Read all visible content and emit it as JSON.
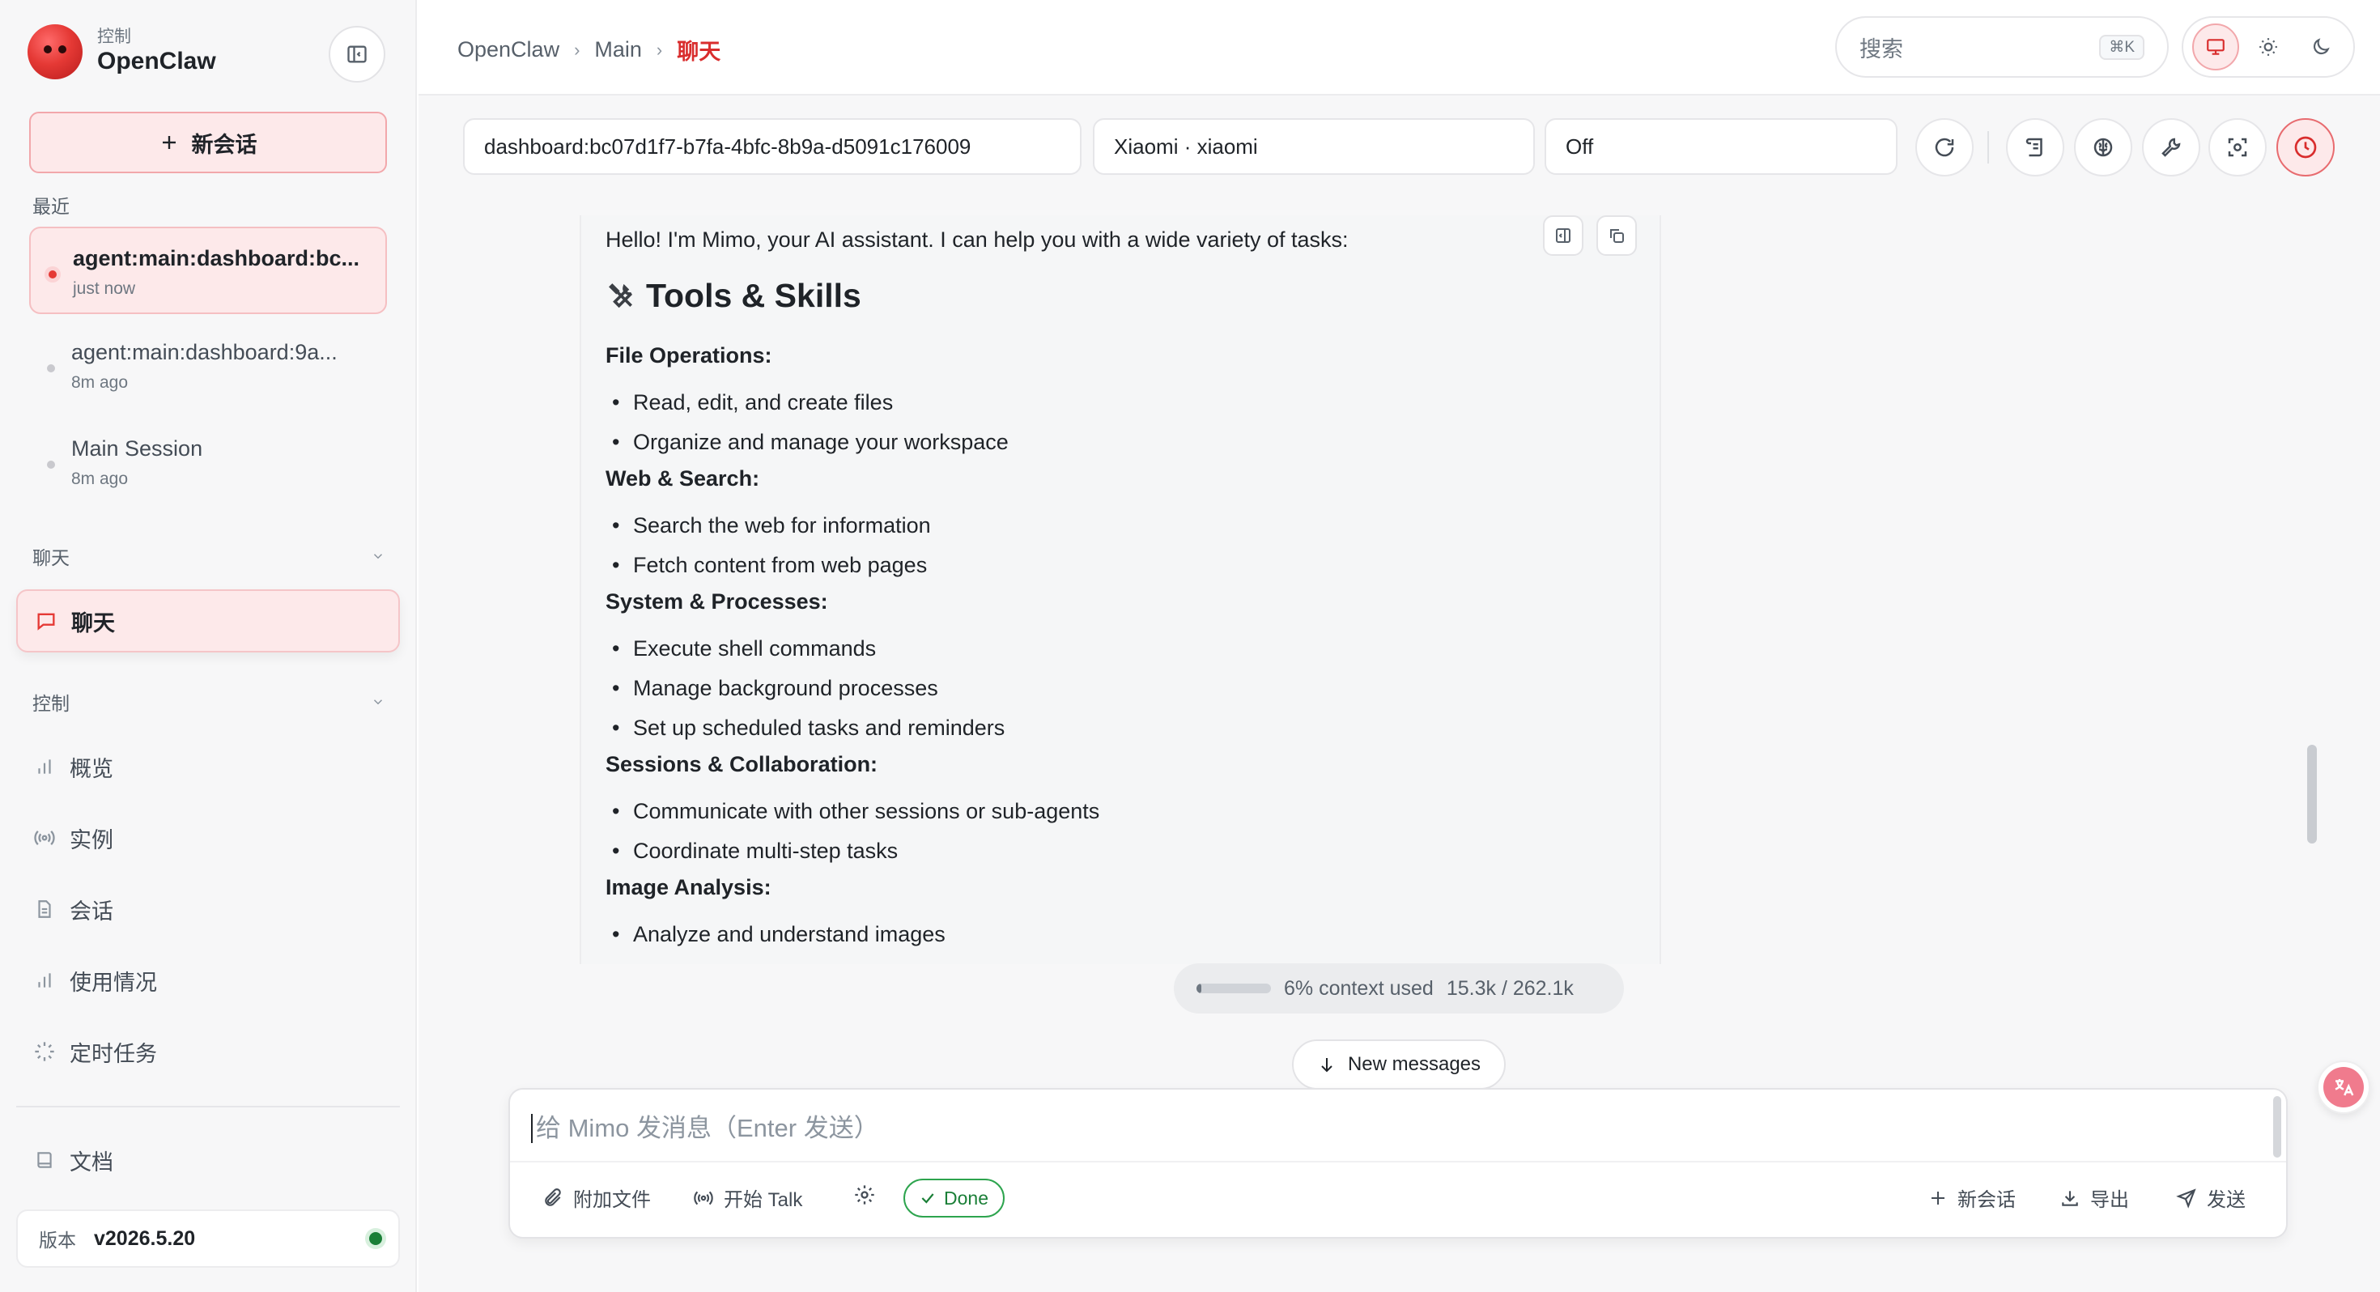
{
  "brand": {
    "subtitle": "控制",
    "name": "OpenClaw"
  },
  "sidebar": {
    "new_chat_label": "新会话",
    "recent_label": "最近",
    "sessions": [
      {
        "title": "agent:main:dashboard:bc...",
        "time": "just now",
        "active": true
      },
      {
        "title": "agent:main:dashboard:9a...",
        "time": "8m ago",
        "active": false
      },
      {
        "title": "Main Session",
        "time": "8m ago",
        "active": false
      }
    ],
    "group_chat": "聊天",
    "nav_chat": "聊天",
    "group_control": "控制",
    "nav_items": [
      "概览",
      "实例",
      "会话",
      "使用情况",
      "定时任务"
    ],
    "nav_docs": "文档",
    "version_label": "版本",
    "version_value": "v2026.5.20"
  },
  "topbar": {
    "breadcrumb": [
      "OpenClaw",
      "Main",
      "聊天"
    ],
    "search_placeholder": "搜索",
    "search_shortcut": "⌘K"
  },
  "session_bar": {
    "session_key": "dashboard:bc07d1f7-b7fa-4bfc-8b9a-d5091c176009",
    "model": "Xiaomi · xiaomi",
    "thinking": "Off"
  },
  "message": {
    "intro": "Hello! I'm Mimo, your AI assistant. I can help you with a wide variety of tasks:",
    "heading": "Tools & Skills",
    "sections": [
      {
        "title": "File Operations:",
        "items": [
          "Read, edit, and create files",
          "Organize and manage your workspace"
        ]
      },
      {
        "title": "Web & Search:",
        "items": [
          "Search the web for information",
          "Fetch content from web pages"
        ]
      },
      {
        "title": "System & Processes:",
        "items": [
          "Execute shell commands",
          "Manage background processes",
          "Set up scheduled tasks and reminders"
        ]
      },
      {
        "title": "Sessions & Collaboration:",
        "items": [
          "Communicate with other sessions or sub-agents",
          "Coordinate multi-step tasks"
        ]
      },
      {
        "title": "Image Analysis:",
        "items": [
          "Analyze and understand images"
        ]
      }
    ]
  },
  "context": {
    "text": "6% context used",
    "tokens": "15.3k / 262.1k",
    "fraction": 0.06
  },
  "new_messages_label": "New messages",
  "composer": {
    "placeholder": "给 Mimo 发消息（Enter 发送）",
    "attach_label": "附加文件",
    "talk_label": "开始 Talk",
    "done_label": "Done",
    "new_session_label": "新会话",
    "export_label": "导出",
    "send_label": "发送"
  },
  "colors": {
    "accent": "#d92d2d",
    "accent_soft": "#fde9ea",
    "online": "#1a7f37"
  }
}
